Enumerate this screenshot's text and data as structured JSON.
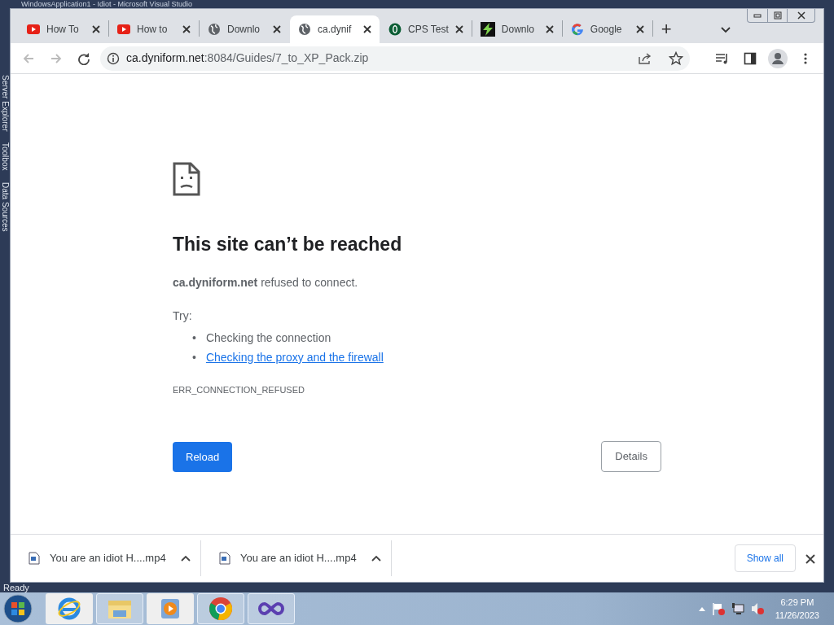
{
  "background_window": {
    "title": "WindowsApplication1 - Idiot - Microsoft Visual Studio",
    "side_panels": [
      "Server Explorer",
      "Toolbox",
      "Data Sources"
    ],
    "status": "Ready"
  },
  "tabs": [
    {
      "kind": "youtube",
      "label": "How To",
      "selected": false
    },
    {
      "kind": "youtube",
      "label": "How to",
      "selected": false
    },
    {
      "kind": "globe",
      "label": "Downlo",
      "selected": false
    },
    {
      "kind": "globe",
      "label": "ca.dynif",
      "selected": true
    },
    {
      "kind": "shield",
      "label": "CPS Test",
      "selected": false
    },
    {
      "kind": "bolt",
      "label": "Downlo",
      "selected": false
    },
    {
      "kind": "google",
      "label": "Google",
      "selected": false
    }
  ],
  "new_tab": "+",
  "address_bar": {
    "host": "ca.dyniform.net",
    "rest": ":8084/Guides/7_to_XP_Pack.zip"
  },
  "error_page": {
    "heading": "This site can’t be reached",
    "message": "**ca.dyniform.net** refused to connect.",
    "try_label": "Try:",
    "suggestions": [
      {
        "marker": "•",
        "text": "Checking the connection",
        "link": false
      },
      {
        "marker": "•",
        "text": "Checking the proxy and the firewall",
        "link": true
      }
    ],
    "code": "ERR_CONNECTION_REFUSED",
    "reload": "Reload",
    "details": "Details"
  },
  "downloads": [
    {
      "name": "You are an idiot H....mp4"
    },
    {
      "name": "You are an idiot H....mp4"
    }
  ],
  "show_all": "Show all",
  "taskbar": {
    "apps": [
      {
        "kind": "ie",
        "pinned_box": false
      },
      {
        "kind": "folder",
        "pinned_box": true
      },
      {
        "kind": "media",
        "pinned_box": false
      },
      {
        "kind": "chrome",
        "pinned_box": true
      },
      {
        "kind": "vs",
        "pinned_box": true
      }
    ],
    "time": "6:29 PM",
    "date": "11/26/2023"
  }
}
